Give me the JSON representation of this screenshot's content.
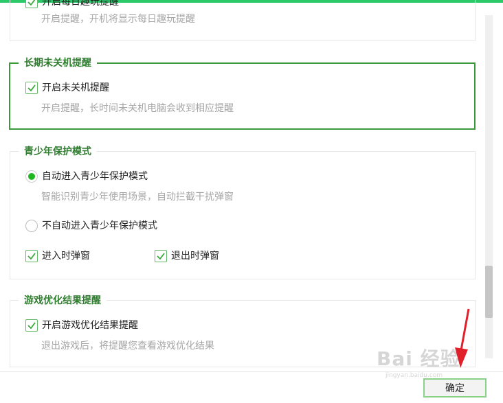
{
  "top_section": {
    "partial_checkbox_label": "开启每日趣玩提醒",
    "desc": "开启提醒，开机将显示每日趣玩提醒",
    "checked": true
  },
  "long_running": {
    "title": "长期未关机提醒",
    "checkbox_label": "开启未关机提醒",
    "checked": true,
    "desc": "开启提醒，长时间未关机电脑会收到相应提醒"
  },
  "youth_mode": {
    "title": "青少年保护模式",
    "auto_label": "自动进入青少年保护模式",
    "auto_selected": true,
    "auto_desc": "智能识别青少年使用场景，自动拦截干扰弹窗",
    "manual_label": "不自动进入青少年保护模式",
    "manual_selected": false,
    "enter_popup_label": "进入时弹窗",
    "enter_popup_checked": true,
    "exit_popup_label": "退出时弹窗",
    "exit_popup_checked": true
  },
  "game_opt": {
    "title": "游戏优化结果提醒",
    "checkbox_label": "开启游戏优化结果提醒",
    "checked": true,
    "desc": "退出游戏后，将提醒您查看游戏优化结果"
  },
  "footer": {
    "ok_label": "确定"
  },
  "watermark": {
    "text": "Bai 经验",
    "sub": "jingyan.baidu.com"
  },
  "colors": {
    "accent": "#2cc96b",
    "check": "#3aa83a",
    "title": "#2f7d2f",
    "arrow": "#e0202a"
  }
}
